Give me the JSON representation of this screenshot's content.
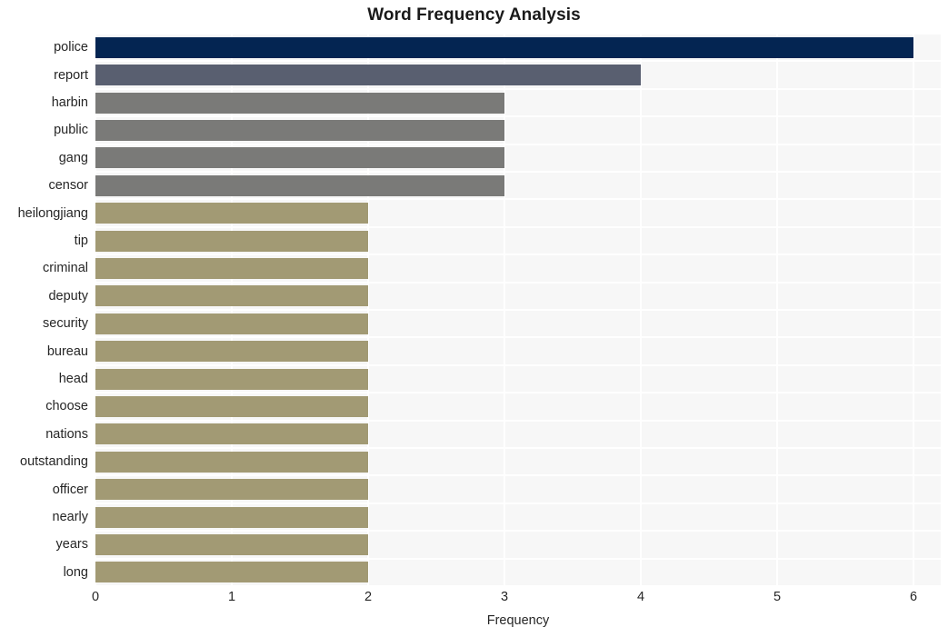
{
  "chart_data": {
    "type": "bar",
    "orientation": "horizontal",
    "title": "Word Frequency Analysis",
    "xlabel": "Frequency",
    "ylabel": "",
    "xlim": [
      0,
      6.2
    ],
    "xticks": [
      0,
      1,
      2,
      3,
      4,
      5,
      6
    ],
    "xtick_labels": [
      "0",
      "1",
      "2",
      "3",
      "4",
      "5",
      "6"
    ],
    "grid": true,
    "legend": null,
    "categories": [
      "police",
      "report",
      "harbin",
      "public",
      "gang",
      "censor",
      "heilongjiang",
      "tip",
      "criminal",
      "deputy",
      "security",
      "bureau",
      "head",
      "choose",
      "nations",
      "outstanding",
      "officer",
      "nearly",
      "years",
      "long"
    ],
    "values": [
      6,
      4,
      3,
      3,
      3,
      3,
      2,
      2,
      2,
      2,
      2,
      2,
      2,
      2,
      2,
      2,
      2,
      2,
      2,
      2
    ],
    "bar_colors": [
      "#042552",
      "#595f70",
      "#7a7a78",
      "#7a7a78",
      "#7a7a78",
      "#7a7a78",
      "#a29a74",
      "#a29a74",
      "#a29a74",
      "#a29a74",
      "#a29a74",
      "#a29a74",
      "#a29a74",
      "#a29a74",
      "#a29a74",
      "#a29a74",
      "#a29a74",
      "#a29a74",
      "#a29a74",
      "#a29a74"
    ],
    "plot_background": "#f7f7f7",
    "gridline_color": "#ffffff",
    "text_color": "#262626"
  }
}
